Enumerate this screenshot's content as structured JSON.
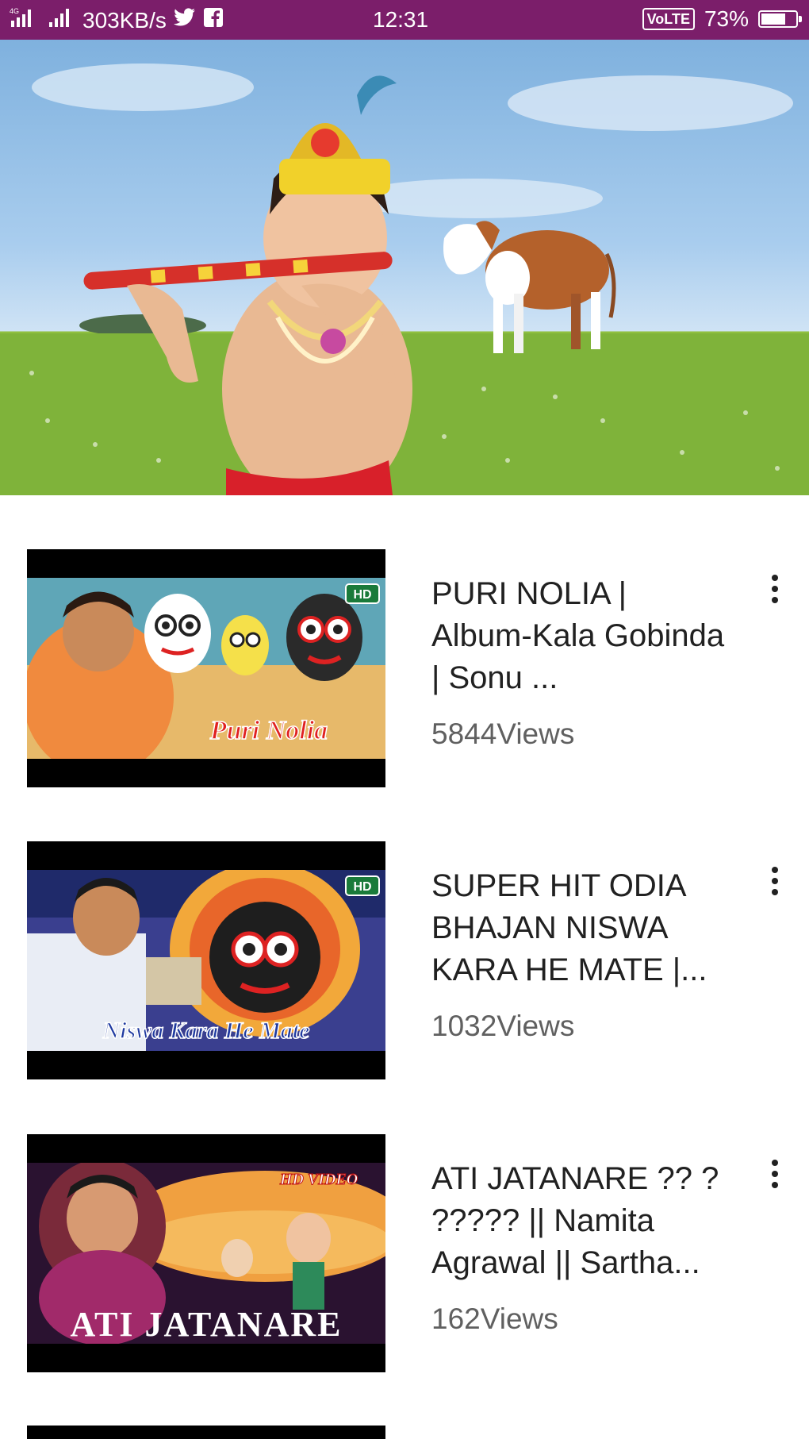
{
  "status_bar": {
    "network_speed": "303KB/s",
    "time": "12:31",
    "lte_label": "VoLTE",
    "battery_percent": "73%",
    "battery_level": 0.73,
    "icons": [
      "signal-4g-icon",
      "signal-icon",
      "twitter-icon",
      "facebook-icon",
      "battery-icon"
    ]
  },
  "hero": {
    "image": "featured-banner-krishna-with-cow"
  },
  "videos": [
    {
      "title": "PURI NOLIA | Album-Kala Gobinda | Sonu ...",
      "views": "5844Views",
      "thumb_text": "Puri Nolia",
      "thumb_badge": "HD"
    },
    {
      "title": "SUPER HIT ODIA BHAJAN NISWA KARA HE MATE |...",
      "views": "1032Views",
      "thumb_text": "Niswa Kara He Mate",
      "thumb_badge": "HD"
    },
    {
      "title": "ATI JATANARE ?? ? ????? || Namita Agrawal || Sartha...",
      "views": "162Views",
      "thumb_text": "ATI JATANARE",
      "thumb_badge": "HD VIDEO"
    }
  ],
  "colors": {
    "status_bar": "#7b1e6a",
    "title_text": "#212121",
    "views_text": "#606060"
  }
}
